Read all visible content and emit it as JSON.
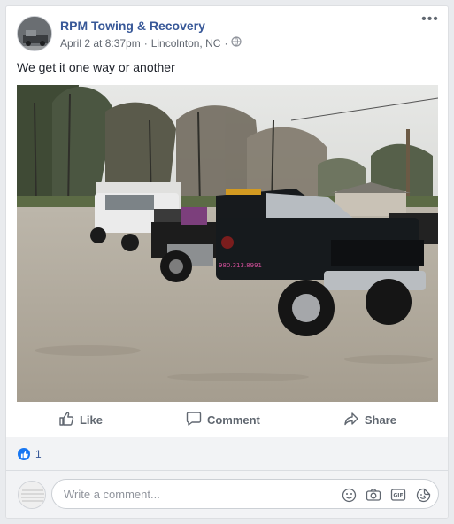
{
  "post": {
    "page_name": "RPM Towing & Recovery",
    "date": "April 2 at 8:37pm",
    "separator": "·",
    "location": "Lincolnton, NC",
    "text": "We get it one way or another",
    "privacy_icon": "globe-icon",
    "photo_text": "980.313.8991"
  },
  "actions": {
    "like": "Like",
    "comment": "Comment",
    "share": "Share"
  },
  "reactions": {
    "count": "1",
    "color": "#1877f2"
  },
  "comment_box": {
    "placeholder": "Write a comment..."
  },
  "colors": {
    "link": "#385898",
    "background": "#e9ebee",
    "muted": "#606770"
  }
}
